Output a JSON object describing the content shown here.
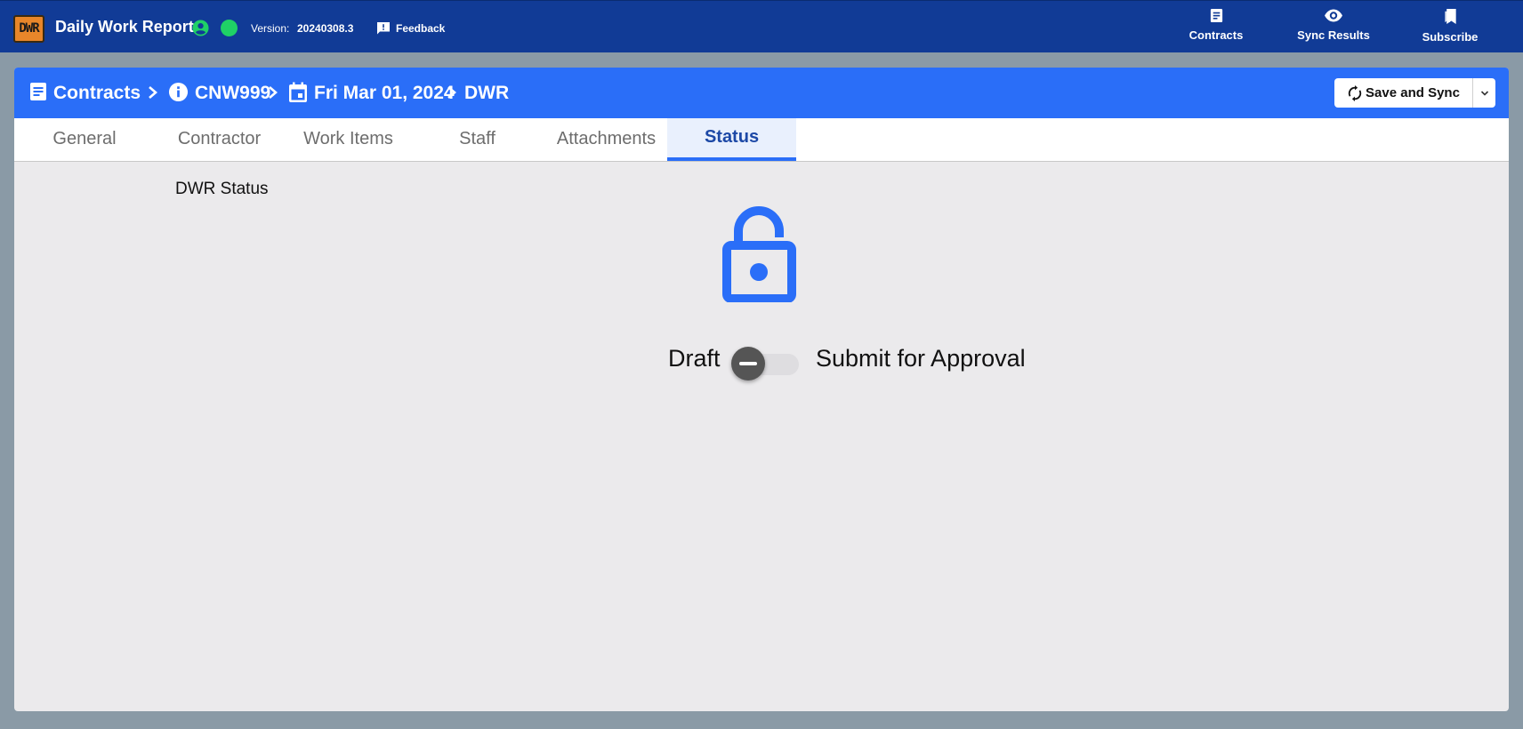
{
  "app": {
    "logo_text": "DWR",
    "title": "Daily Work Report",
    "version_label": "Version:",
    "version_value": "20240308.3",
    "feedback_label": "Feedback",
    "online_color": "#1fd166"
  },
  "top_nav": [
    {
      "label": "Contracts",
      "icon": "document-icon"
    },
    {
      "label": "Sync Results",
      "icon": "eye-icon"
    },
    {
      "label": "Subscribe",
      "icon": "bookmark-icon"
    }
  ],
  "breadcrumb": [
    {
      "label": "Contracts",
      "icon": "list-document-icon"
    },
    {
      "label": "CNW999",
      "icon": "info-icon"
    },
    {
      "label": "Fri Mar 01, 2024",
      "icon": "calendar-icon"
    },
    {
      "label": "DWR"
    }
  ],
  "toolbar": {
    "save_label": "Save and Sync"
  },
  "tabs": [
    {
      "label": "General",
      "active": false
    },
    {
      "label": "Contractor",
      "active": false
    },
    {
      "label": "Work Items",
      "active": false
    },
    {
      "label": "Staff",
      "active": false
    },
    {
      "label": "Attachments",
      "active": false
    },
    {
      "label": "Status",
      "active": true
    }
  ],
  "status": {
    "section_title": "DWR Status",
    "lock_icon": "unlocked-padlock-icon",
    "draft_label": "Draft",
    "submit_label": "Submit for Approval",
    "submitted": false
  },
  "colors": {
    "app_bar": "#113b96",
    "card_header": "#2a6ef8",
    "lock": "#2a6ef8"
  }
}
